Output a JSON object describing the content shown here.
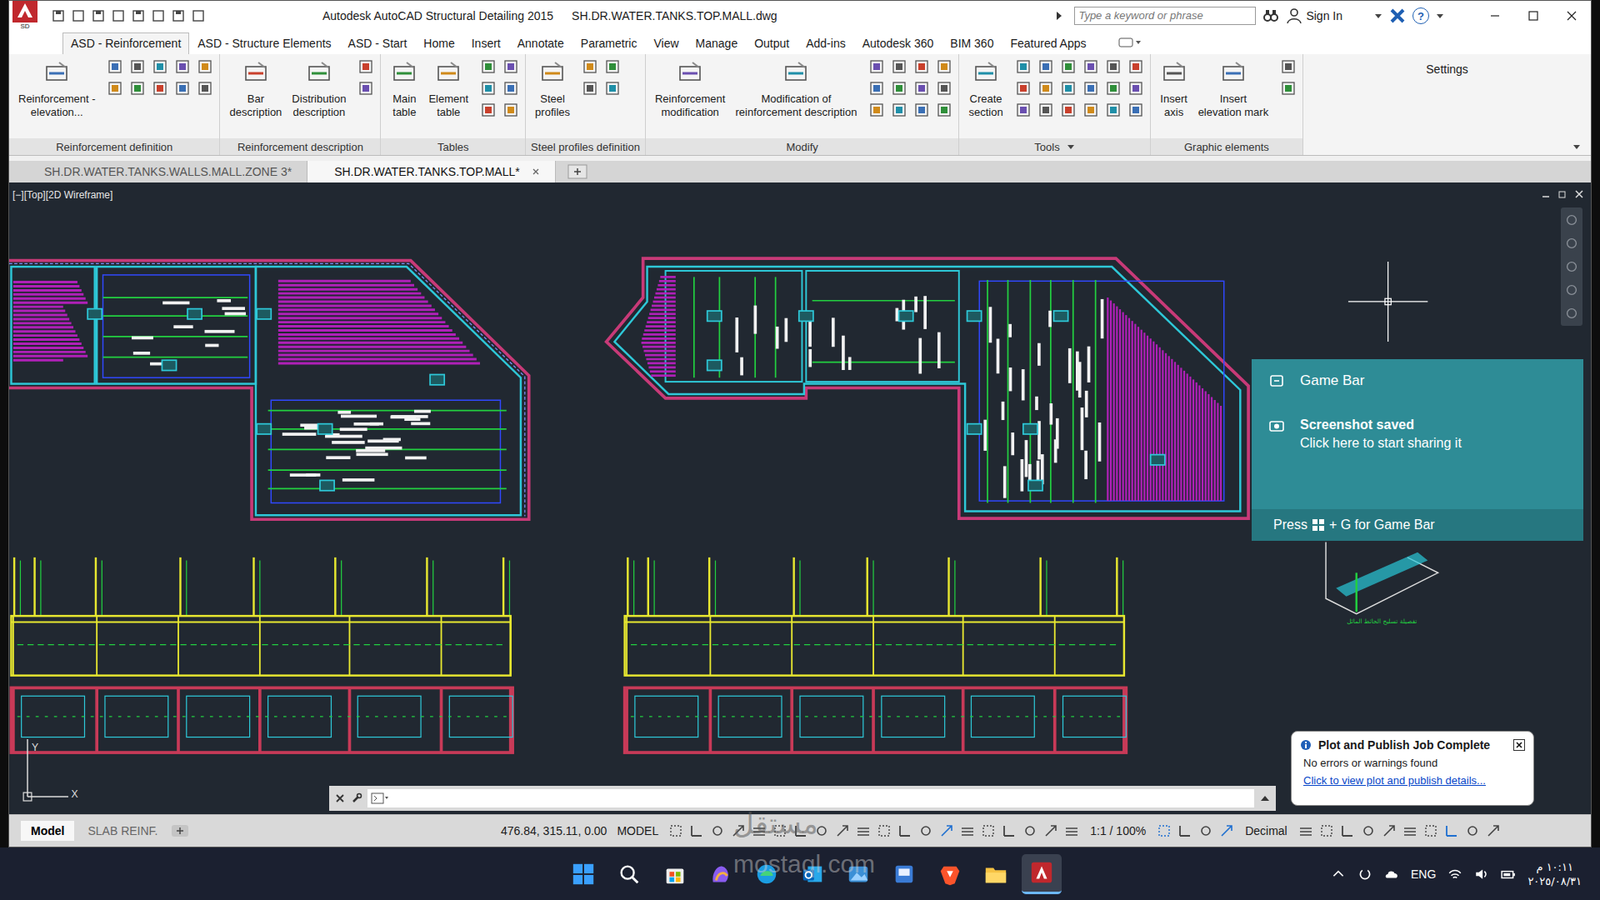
{
  "window": {
    "title": "Autodesk AutoCAD Structural Detailing 2015",
    "file": "SH.DR.WATER.TANKS.TOP.MALL.dwg",
    "badge": "SD"
  },
  "search": {
    "placeholder": "Type a keyword or phrase"
  },
  "account": {
    "label": "Sign In"
  },
  "help": {
    "label": "?"
  },
  "ribbon_tabs": [
    {
      "label": "ASD - Reinforcement",
      "selected": true
    },
    {
      "label": "ASD - Structure Elements",
      "selected": false
    },
    {
      "label": "ASD - Start",
      "selected": false
    },
    {
      "label": "Home",
      "selected": false
    },
    {
      "label": "Insert",
      "selected": false
    },
    {
      "label": "Annotate",
      "selected": false
    },
    {
      "label": "Parametric",
      "selected": false
    },
    {
      "label": "View",
      "selected": false
    },
    {
      "label": "Manage",
      "selected": false
    },
    {
      "label": "Output",
      "selected": false
    },
    {
      "label": "Add-ins",
      "selected": false
    },
    {
      "label": "Autodesk 360",
      "selected": false
    },
    {
      "label": "BIM 360",
      "selected": false
    },
    {
      "label": "Featured Apps",
      "selected": false
    }
  ],
  "ribbon_panels": [
    {
      "title": "Reinforcement definition",
      "has_menu": false,
      "buttons": [
        [
          "Reinforcement -",
          "elevation..."
        ]
      ]
    },
    {
      "title": "Reinforcement description",
      "has_menu": false,
      "buttons": [
        [
          "Bar",
          "description"
        ],
        [
          "Distribution",
          "description"
        ]
      ]
    },
    {
      "title": "Tables",
      "has_menu": false,
      "buttons": [
        [
          "Main",
          "table"
        ],
        [
          "Element",
          "table"
        ]
      ]
    },
    {
      "title": "Steel profiles definition",
      "has_menu": false,
      "buttons": [
        [
          "Steel",
          "profiles"
        ]
      ]
    },
    {
      "title": "Modify",
      "has_menu": false,
      "buttons": [
        [
          "Reinforcement",
          "modification"
        ],
        [
          "Modification of",
          "reinforcement description"
        ]
      ]
    },
    {
      "title": "Tools",
      "has_menu": true,
      "buttons": [
        [
          "Create",
          "section"
        ]
      ]
    },
    {
      "title": "Graphic elements",
      "has_menu": false,
      "buttons": [
        [
          "Insert",
          "axis"
        ],
        [
          "Insert",
          "elevation mark"
        ]
      ]
    }
  ],
  "ribbon_settings": {
    "label": "Settings"
  },
  "file_tabs": [
    {
      "label": "SH.DR.WATER.TANKS.WALLS.MALL.ZONE 3*",
      "selected": false
    },
    {
      "label": "SH.DR.WATER.TANKS.TOP.MALL*",
      "selected": true
    }
  ],
  "viewport": {
    "label": "[−][Top][2D Wireframe]"
  },
  "drawing": {
    "caption": "تفصيلة تسليح الحائط المائل",
    "ucs_y": "Y",
    "ucs_x": "X"
  },
  "game_bar": {
    "title": "Game Bar",
    "heading": "Screenshot saved",
    "body": "Click here to start sharing it",
    "hint_before": "Press",
    "hint_after": "+ G for Game Bar"
  },
  "balloon": {
    "title": "Plot and Publish Job Complete",
    "body": "No errors or warnings found",
    "link": "Click to view plot and publish details..."
  },
  "layout_tabs": [
    {
      "label": "Model",
      "selected": true
    },
    {
      "label": "SLAB REINF.",
      "selected": false
    }
  ],
  "status_bar": {
    "coordinates": "476.84, 315.11, 0.00",
    "space": "MODEL",
    "scale": "1:1 / 100%",
    "units": "Decimal"
  },
  "taskbar": {
    "language": "ENG",
    "time": "١٠:١١ م",
    "date": "٢٠٢٥/٠٨/٣١",
    "apps": [
      {
        "kind": "start",
        "selected": false
      },
      {
        "kind": "search",
        "selected": false
      },
      {
        "kind": "store",
        "selected": false
      },
      {
        "kind": "copilot",
        "selected": false
      },
      {
        "kind": "edge",
        "selected": false
      },
      {
        "kind": "outlook",
        "selected": false
      },
      {
        "kind": "photos",
        "selected": false
      },
      {
        "kind": "control",
        "selected": false
      },
      {
        "kind": "brave",
        "selected": false
      },
      {
        "kind": "explorer",
        "selected": false
      },
      {
        "kind": "autocad",
        "selected": true
      }
    ]
  },
  "watermark": {
    "arabic": "مستقل",
    "latin": "mostaql.com"
  }
}
